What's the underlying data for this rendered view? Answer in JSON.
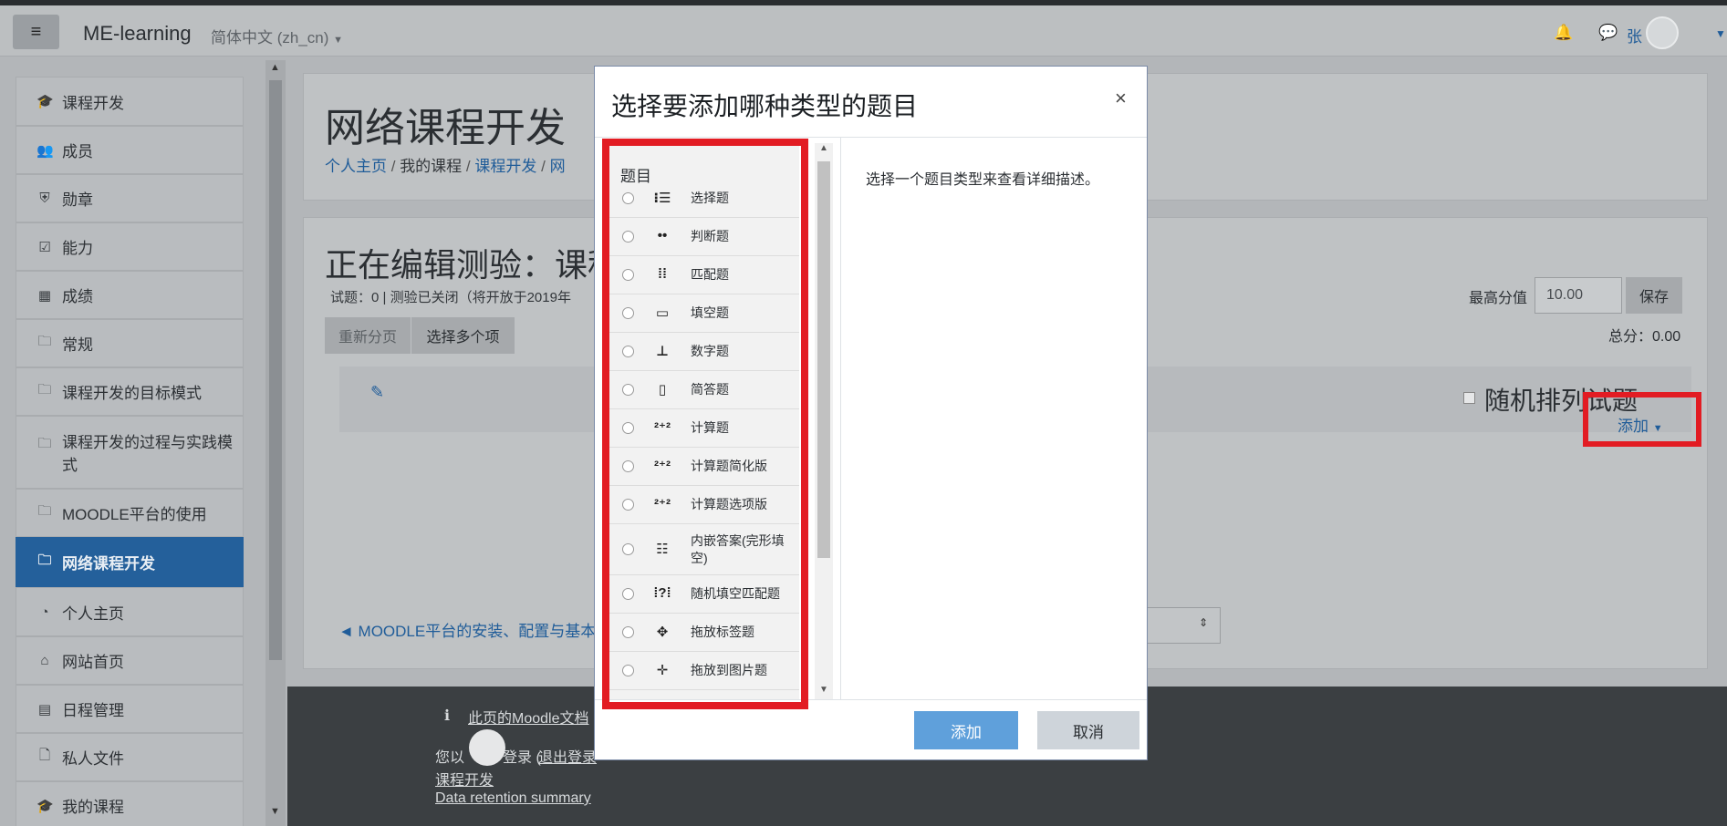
{
  "navbar": {
    "brand": "ME-learning",
    "language": "简体中文 (zh_cn)",
    "user_name": "张"
  },
  "sidebar": {
    "items": [
      {
        "label": "课程开发",
        "icon": "graduation-cap-icon",
        "glyph": "🎓",
        "active": false
      },
      {
        "label": "成员",
        "icon": "users-icon",
        "glyph": "👥",
        "active": false
      },
      {
        "label": "勋章",
        "icon": "shield-icon",
        "glyph": "⛨",
        "active": false
      },
      {
        "label": "能力",
        "icon": "checkbox-icon",
        "glyph": "☑",
        "active": false
      },
      {
        "label": "成绩",
        "icon": "table-icon",
        "glyph": "▦",
        "active": false
      },
      {
        "label": "常规",
        "icon": "folder-icon",
        "glyph": "🗀",
        "active": false
      },
      {
        "label": "课程开发的目标模式",
        "icon": "folder-icon",
        "glyph": "🗀",
        "active": false
      },
      {
        "label": "课程开发的过程与实践模式",
        "icon": "folder-icon",
        "glyph": "🗀",
        "active": false
      },
      {
        "label": "MOODLE平台的使用",
        "icon": "folder-icon",
        "glyph": "🗀",
        "active": false
      },
      {
        "label": "网络课程开发",
        "icon": "folder-icon",
        "glyph": "🗀",
        "active": true
      },
      {
        "label": "个人主页",
        "icon": "dashboard-icon",
        "glyph": "◔",
        "active": false
      },
      {
        "label": "网站首页",
        "icon": "home-icon",
        "glyph": "⌂",
        "active": false
      },
      {
        "label": "日程管理",
        "icon": "calendar-icon",
        "glyph": "▤",
        "active": false
      },
      {
        "label": "私人文件",
        "icon": "file-icon",
        "glyph": "🗋",
        "active": false
      },
      {
        "label": "我的课程",
        "icon": "graduation-cap-icon",
        "glyph": "🎓",
        "active": false
      }
    ]
  },
  "header": {
    "title": "网络课程开发",
    "breadcrumb": [
      "个人主页",
      "我的课程",
      "课程开发",
      "网"
    ]
  },
  "main": {
    "edit_title": "正在编辑测验：课程",
    "quiz_info": "试题：0 | 测验已关闭（将开放于2019年",
    "repaginate_label": "重新分页",
    "select_multiple_label": "选择多个项",
    "max_grade_label": "最高分值",
    "max_grade_value": "10.00",
    "save_label": "保存",
    "total_label": "总分：0.00",
    "shuffle_label": "随机排列试题",
    "add_label": "添加",
    "prev_link": "◄ MOODLE平台的安装、配置与基本使"
  },
  "footer": {
    "docs_link": "此页的Moodle文档",
    "logged_in_text": "您以",
    "logged_in_suffix": "登录 (",
    "logout_link": "退出登录",
    "course_link": "课程开发",
    "retention_link": "Data retention summary"
  },
  "modal": {
    "title": "选择要添加哪种类型的题目",
    "close": "×",
    "section_heading": "题目",
    "description": "选择一个题目类型来查看详细描述。",
    "add_button": "添加",
    "cancel_button": "取消",
    "options": [
      {
        "label": "选择题",
        "icon": "multichoice-icon",
        "glyph": "⁝☰"
      },
      {
        "label": "判断题",
        "icon": "truefalse-icon",
        "glyph": "••"
      },
      {
        "label": "匹配题",
        "icon": "match-icon",
        "glyph": "⁞⁞"
      },
      {
        "label": "填空题",
        "icon": "shortanswer-icon",
        "glyph": "▭"
      },
      {
        "label": "数字题",
        "icon": "numerical-icon",
        "glyph": "⊥"
      },
      {
        "label": "简答题",
        "icon": "essay-icon",
        "glyph": "▯"
      },
      {
        "label": "计算题",
        "icon": "calculated-icon",
        "glyph": "²⁺²"
      },
      {
        "label": "计算题简化版",
        "icon": "calculatedsimple-icon",
        "glyph": "²⁺²"
      },
      {
        "label": "计算题选项版",
        "icon": "calculatedmulti-icon",
        "glyph": "²⁺²"
      },
      {
        "label": "内嵌答案(完形填空)",
        "icon": "cloze-icon",
        "glyph": "☷"
      },
      {
        "label": "随机填空匹配题",
        "icon": "randomsamatch-icon",
        "glyph": "⁞?⁞"
      },
      {
        "label": "拖放标签题",
        "icon": "ddmarker-icon",
        "glyph": "✥"
      },
      {
        "label": "拖放到图片题",
        "icon": "ddimageortext-icon",
        "glyph": "✛"
      }
    ]
  }
}
